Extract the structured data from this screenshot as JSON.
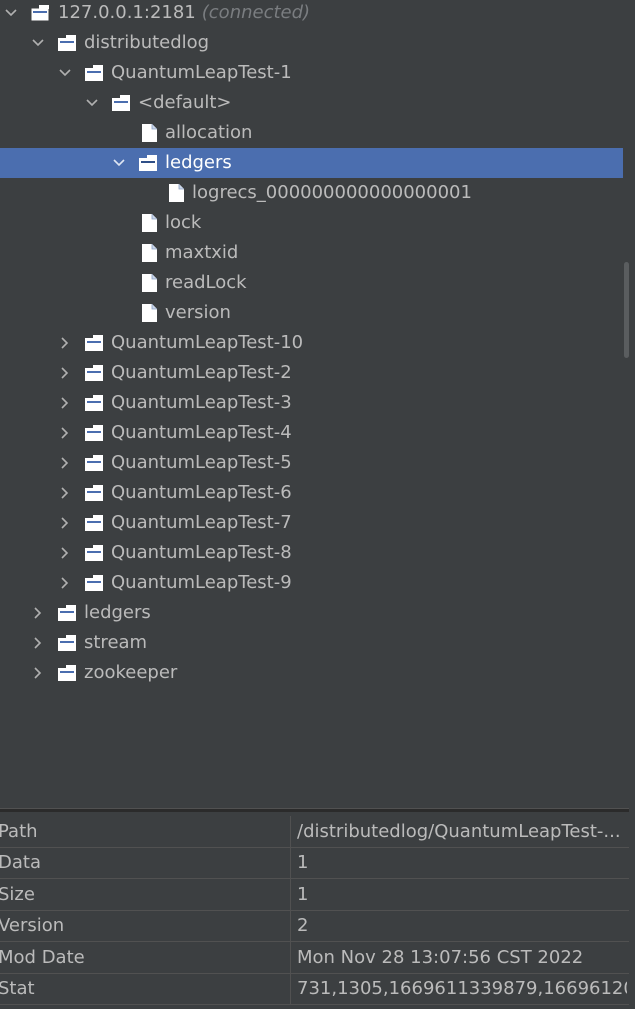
{
  "tree": {
    "root": {
      "label": "127.0.0.1:2181",
      "status": "(connected)"
    },
    "nodes": [
      {
        "label": "distributedlog"
      },
      {
        "label": "QuantumLeapTest-1"
      },
      {
        "label": "<default>"
      },
      {
        "label": "allocation"
      },
      {
        "label": "ledgers"
      },
      {
        "label": "logrecs_000000000000000001"
      },
      {
        "label": "lock"
      },
      {
        "label": "maxtxid"
      },
      {
        "label": "readLock"
      },
      {
        "label": "version"
      },
      {
        "label": "QuantumLeapTest-10"
      },
      {
        "label": "QuantumLeapTest-2"
      },
      {
        "label": "QuantumLeapTest-3"
      },
      {
        "label": "QuantumLeapTest-4"
      },
      {
        "label": "QuantumLeapTest-5"
      },
      {
        "label": "QuantumLeapTest-6"
      },
      {
        "label": "QuantumLeapTest-7"
      },
      {
        "label": "QuantumLeapTest-8"
      },
      {
        "label": "QuantumLeapTest-9"
      },
      {
        "label": "ledgers"
      },
      {
        "label": "stream"
      },
      {
        "label": "zookeeper"
      }
    ]
  },
  "properties": [
    {
      "key": "Path",
      "value": "/distributedlog/QuantumLeapTest-..."
    },
    {
      "key": "Data",
      "value": "1"
    },
    {
      "key": "Size",
      "value": "1"
    },
    {
      "key": "Version",
      "value": "2"
    },
    {
      "key": "Mod Date",
      "value": "Mon Nov 28 13:07:56 CST 2022"
    },
    {
      "key": "Stat",
      "value": "731,1305,1669611339879,16696120..."
    }
  ],
  "colors": {
    "background": "#3c3f41",
    "selection": "#4b6eaf",
    "text": "#bbbbbb",
    "dim_text": "#7a7d80"
  },
  "icons": {
    "expanded": "chevron-down-icon",
    "collapsed": "chevron-right-icon",
    "folder": "folder-icon",
    "file": "file-icon"
  }
}
